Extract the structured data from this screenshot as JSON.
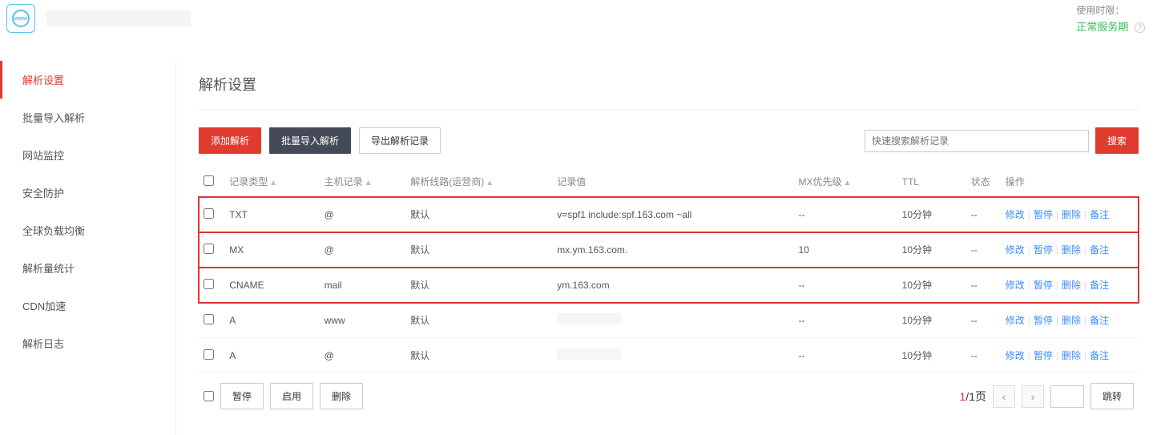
{
  "header": {
    "usage_label": "使用时限：",
    "status_text": "正常服务期"
  },
  "sidebar": {
    "items": [
      {
        "label": "解析设置",
        "active": true
      },
      {
        "label": "批量导入解析",
        "active": false
      },
      {
        "label": "网站监控",
        "active": false
      },
      {
        "label": "安全防护",
        "active": false
      },
      {
        "label": "全球负载均衡",
        "active": false
      },
      {
        "label": "解析量统计",
        "active": false
      },
      {
        "label": "CDN加速",
        "active": false
      },
      {
        "label": "解析日志",
        "active": false
      }
    ]
  },
  "page": {
    "title": "解析设置"
  },
  "toolbar": {
    "add_label": "添加解析",
    "bulk_import_label": "批量导入解析",
    "export_label": "导出解析记录",
    "search_placeholder": "快速搜索解析记录",
    "search_btn": "搜索"
  },
  "table": {
    "headers": {
      "type": "记录类型",
      "host": "主机记录",
      "line": "解析线路(运营商)",
      "value": "记录值",
      "mx": "MX优先级",
      "ttl": "TTL",
      "status": "状态",
      "ops": "操作"
    },
    "rows": [
      {
        "type": "TXT",
        "host": "@",
        "line": "默认",
        "value": "v=spf1 include:spf.163.com ~all",
        "mx": "--",
        "ttl": "10分钟",
        "status": "--",
        "highlighted": true,
        "obscured": false
      },
      {
        "type": "MX",
        "host": "@",
        "line": "默认",
        "value": "mx.ym.163.com.",
        "mx": "10",
        "ttl": "10分钟",
        "status": "--",
        "highlighted": true,
        "obscured": false
      },
      {
        "type": "CNAME",
        "host": "mail",
        "line": "默认",
        "value": "ym.163.com",
        "mx": "--",
        "ttl": "10分钟",
        "status": "--",
        "highlighted": true,
        "obscured": false
      },
      {
        "type": "A",
        "host": "www",
        "line": "默认",
        "value": "",
        "mx": "--",
        "ttl": "10分钟",
        "status": "--",
        "highlighted": false,
        "obscured": true
      },
      {
        "type": "A",
        "host": "@",
        "line": "默认",
        "value": "",
        "mx": "--",
        "ttl": "10分钟",
        "status": "--",
        "highlighted": false,
        "obscured": true
      }
    ],
    "ops": {
      "edit": "修改",
      "pause": "暂停",
      "delete": "删除",
      "remark": "备注"
    }
  },
  "footer": {
    "pause": "暂停",
    "enable": "启用",
    "delete": "删除",
    "page_current": "1",
    "page_total": "1",
    "page_suffix": "页",
    "jump": "跳转"
  }
}
